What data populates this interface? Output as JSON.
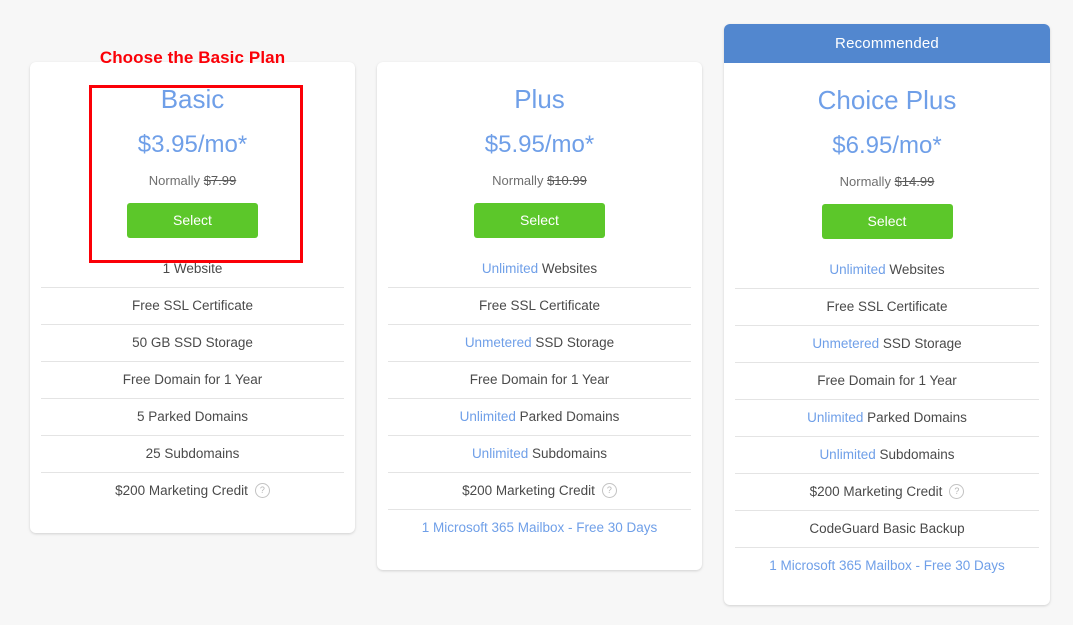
{
  "annotation": {
    "title": "Choose the Basic Plan",
    "highlight_color": "#fb0007"
  },
  "theme": {
    "page_background": "#f7f7f7",
    "accent_blue": "#6f9fe8",
    "banner_blue": "#5287cf",
    "button_green": "#5cc72a",
    "text_gray": "#4a4a4a"
  },
  "common": {
    "normally_label": "Normally",
    "select_label": "Select",
    "help_icon_glyph": "?"
  },
  "plans": [
    {
      "id": "basic",
      "name": "Basic",
      "price": "$3.95/mo*",
      "normally_label": "Normally",
      "original_price": "$7.99",
      "select_label": "Select",
      "badge": null,
      "features": [
        {
          "prefix": "",
          "text": "1 Website",
          "help": false,
          "link": false
        },
        {
          "prefix": "",
          "text": "Free SSL Certificate",
          "help": false,
          "link": false
        },
        {
          "prefix": "",
          "text": "50 GB SSD Storage",
          "help": false,
          "link": false
        },
        {
          "prefix": "",
          "text": "Free Domain for 1 Year",
          "help": false,
          "link": false
        },
        {
          "prefix": "",
          "text": "5 Parked Domains",
          "help": false,
          "link": false
        },
        {
          "prefix": "",
          "text": "25 Subdomains",
          "help": false,
          "link": false
        },
        {
          "prefix": "",
          "text": "$200 Marketing Credit",
          "help": true,
          "link": false
        }
      ]
    },
    {
      "id": "plus",
      "name": "Plus",
      "price": "$5.95/mo*",
      "normally_label": "Normally",
      "original_price": "$10.99",
      "select_label": "Select",
      "badge": null,
      "features": [
        {
          "prefix": "Unlimited",
          "text": "Websites",
          "help": false,
          "link": false
        },
        {
          "prefix": "",
          "text": "Free SSL Certificate",
          "help": false,
          "link": false
        },
        {
          "prefix": "Unmetered",
          "text": "SSD Storage",
          "help": false,
          "link": false
        },
        {
          "prefix": "",
          "text": "Free Domain for 1 Year",
          "help": false,
          "link": false
        },
        {
          "prefix": "Unlimited",
          "text": "Parked Domains",
          "help": false,
          "link": false
        },
        {
          "prefix": "Unlimited",
          "text": "Subdomains",
          "help": false,
          "link": false
        },
        {
          "prefix": "",
          "text": "$200 Marketing Credit",
          "help": true,
          "link": false
        },
        {
          "prefix": "",
          "text": "1 Microsoft 365 Mailbox - Free 30 Days",
          "help": false,
          "link": true
        }
      ]
    },
    {
      "id": "choice-plus",
      "name": "Choice Plus",
      "price": "$6.95/mo*",
      "normally_label": "Normally",
      "original_price": "$14.99",
      "select_label": "Select",
      "badge": "Recommended",
      "features": [
        {
          "prefix": "Unlimited",
          "text": "Websites",
          "help": false,
          "link": false
        },
        {
          "prefix": "",
          "text": "Free SSL Certificate",
          "help": false,
          "link": false
        },
        {
          "prefix": "Unmetered",
          "text": "SSD Storage",
          "help": false,
          "link": false
        },
        {
          "prefix": "",
          "text": "Free Domain for 1 Year",
          "help": false,
          "link": false
        },
        {
          "prefix": "Unlimited",
          "text": "Parked Domains",
          "help": false,
          "link": false
        },
        {
          "prefix": "Unlimited",
          "text": "Subdomains",
          "help": false,
          "link": false
        },
        {
          "prefix": "",
          "text": "$200 Marketing Credit",
          "help": true,
          "link": false
        },
        {
          "prefix": "",
          "text": "CodeGuard Basic Backup",
          "help": false,
          "link": false
        },
        {
          "prefix": "",
          "text": "1 Microsoft 365 Mailbox - Free 30 Days",
          "help": false,
          "link": true
        }
      ]
    }
  ]
}
